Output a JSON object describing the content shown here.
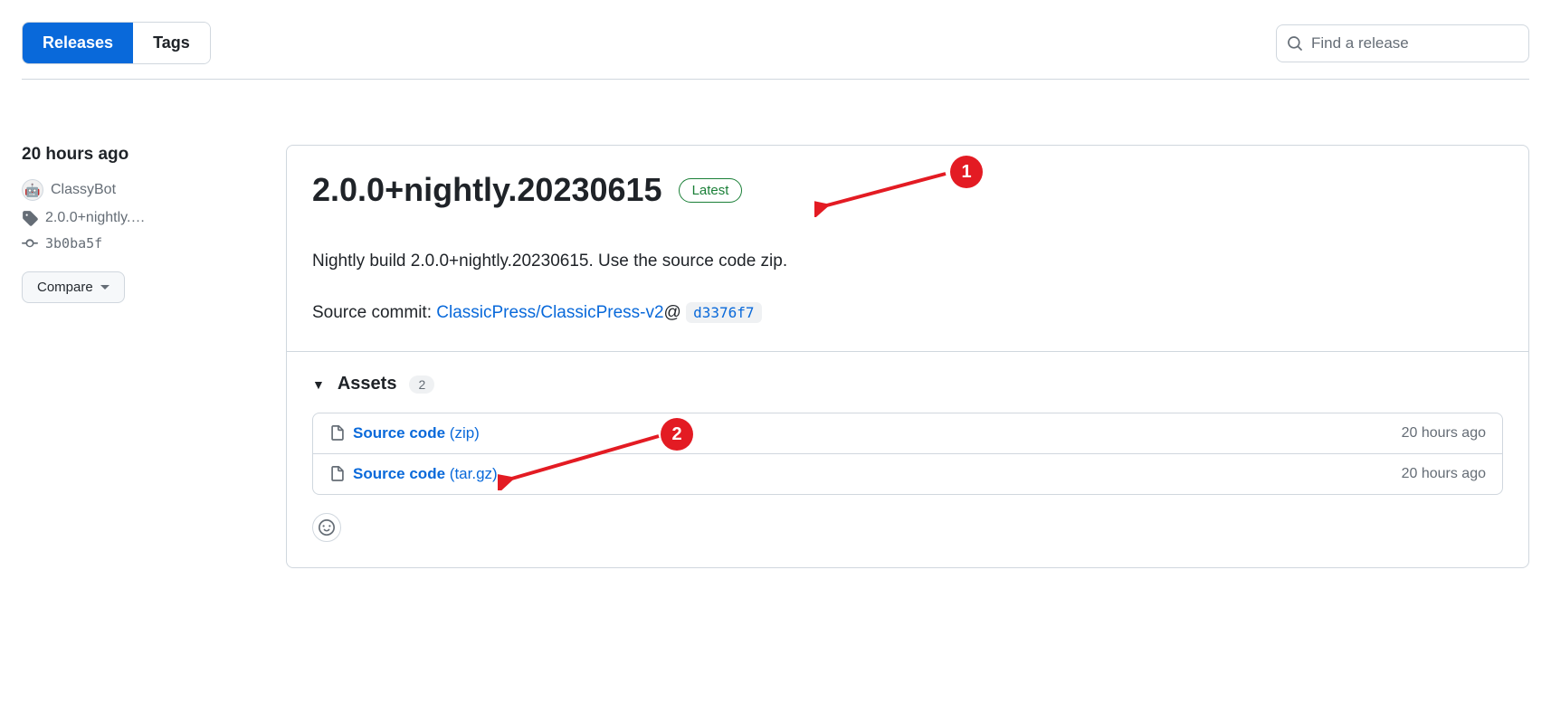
{
  "topbar": {
    "tabs": {
      "releases": "Releases",
      "tags": "Tags"
    },
    "search_placeholder": "Find a release"
  },
  "sidebar": {
    "time": "20 hours ago",
    "author": "ClassyBot",
    "tag": "2.0.0+nightly.…",
    "commit": "3b0ba5f",
    "compare_label": "Compare"
  },
  "release": {
    "title": "2.0.0+nightly.20230615",
    "latest_label": "Latest",
    "description": "Nightly build 2.0.0+nightly.20230615. Use the source code zip.",
    "source_commit_prefix": "Source commit: ",
    "source_commit_repo": "ClassicPress/ClassicPress-v2",
    "source_commit_at": "@",
    "source_commit_sha": "d3376f7"
  },
  "assets": {
    "heading": "Assets",
    "count": "2",
    "items": [
      {
        "name": "Source code",
        "ext": "(zip)",
        "time": "20 hours ago"
      },
      {
        "name": "Source code",
        "ext": "(tar.gz)",
        "time": "20 hours ago"
      }
    ]
  },
  "annotations": {
    "one": "1",
    "two": "2"
  }
}
